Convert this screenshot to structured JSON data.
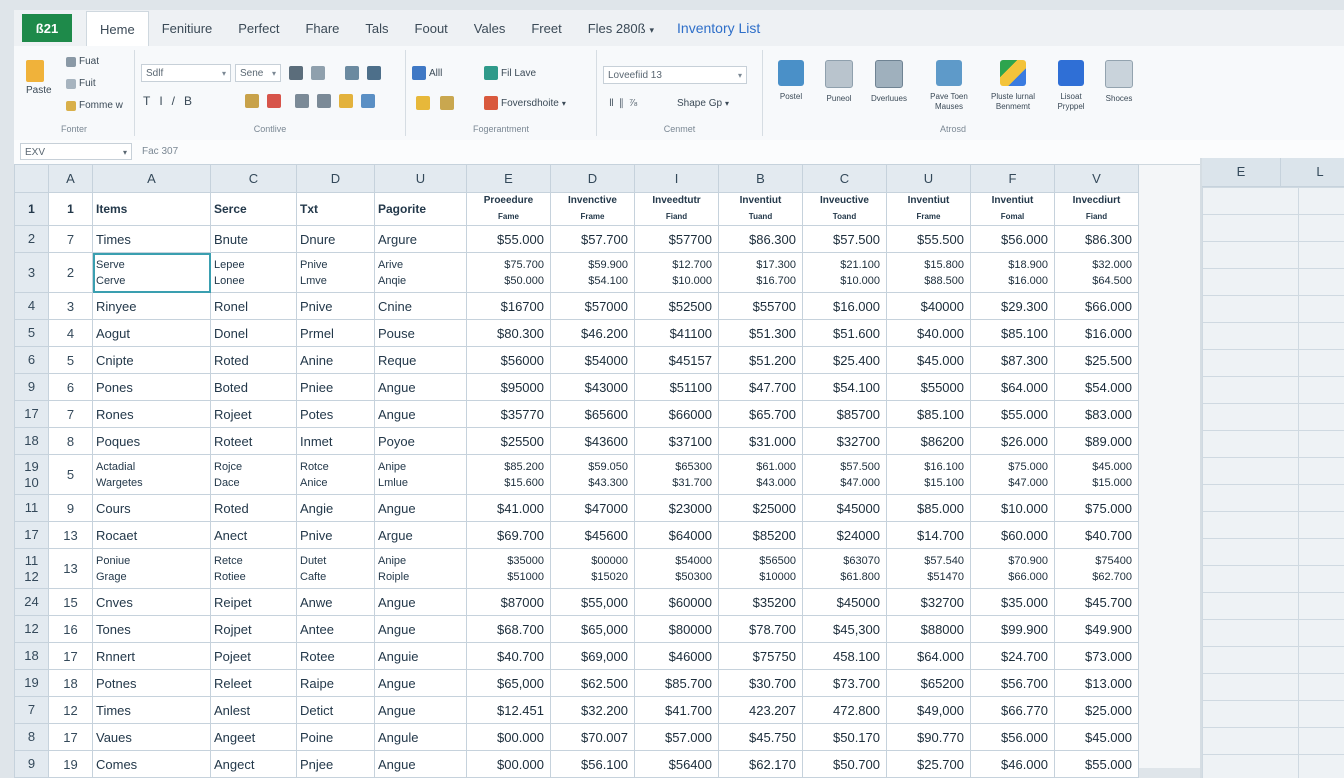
{
  "menubar": {
    "logo": "ß21",
    "tabs": [
      "Heme",
      "Fenitiure",
      "Perfect",
      "Fhare",
      "Tals",
      "Foout",
      "Vales",
      "Freet"
    ],
    "file_selector": "Fles 280ß",
    "doc_title": "Inventory List"
  },
  "ribbon": {
    "clipboard": {
      "paste": "Paste",
      "cut": "Fuat",
      "copy": "Fuit",
      "format": "Fomme w",
      "label": "Fonter"
    },
    "font": {
      "font_name": "Sdlf",
      "size": "Sene",
      "label": "Contlive"
    },
    "alignment": {
      "wrap": "Alll",
      "merge": "Fil Lave",
      "number_format": "Foversdhoite",
      "label": "Fogerantment"
    },
    "number": {
      "format_box": "Loveefiid 13",
      "style_box": "Shape Gp",
      "label": "Cenmet"
    },
    "insert": {
      "buttons": [
        {
          "label": "Postel",
          "icon": "chart-icon"
        },
        {
          "label": "Puneol",
          "icon": "table-icon"
        },
        {
          "label": "Dverluues",
          "icon": "pivot-icon"
        },
        {
          "label": "Pave Toen\nMauses",
          "icon": "picture-icon"
        },
        {
          "label": "Pluste lurnal\nBenmemt",
          "icon": "drive-icon"
        },
        {
          "label": "Lisoat\nPryppel",
          "icon": "form-icon"
        },
        {
          "label": "Shoces",
          "icon": "settings-icon"
        }
      ],
      "label": "Atrosd"
    }
  },
  "formula_bar": {
    "name_box": "EXV",
    "fx": "Fac 307"
  },
  "grid": {
    "col_letters": [
      "A",
      "A",
      "C",
      "D",
      "U",
      "E",
      "D",
      "I",
      "B",
      "C",
      "U",
      "F",
      "V"
    ],
    "header_row": {
      "row_label": "1",
      "idx": "1",
      "cols": [
        "Items",
        "Serce",
        "Txt",
        "Pagorite"
      ],
      "inv_cols": [
        [
          "Proeedure",
          "Fame"
        ],
        [
          "Invenctive",
          "Frame"
        ],
        [
          "Inveedtutr",
          "Fiand"
        ],
        [
          "Inventiut",
          "Tuand"
        ],
        [
          "Inveuctive",
          "Toand"
        ],
        [
          "Inventiut",
          "Frame"
        ],
        [
          "Inventiut",
          "Fomal"
        ],
        [
          "Invecdiurt",
          "Fiand"
        ]
      ]
    },
    "rows": [
      {
        "row": "2",
        "idx": "7",
        "c": [
          "Times",
          "Bnute",
          "Dnure",
          "Argure"
        ],
        "v": [
          "$55.000",
          "$57.700",
          "$57700",
          "$86.300",
          "$57.500",
          "$55.500",
          "$56.000",
          "$86.300"
        ]
      },
      {
        "row": "3",
        "idx": "2",
        "dual": true,
        "c2": [
          [
            "Serve",
            "Cerve"
          ],
          [
            "Lepee",
            "Lonee"
          ],
          [
            "Pnive",
            "Lmve"
          ],
          [
            "Arive",
            "Anqie"
          ]
        ],
        "v2": [
          [
            "$75.700",
            "$50.000"
          ],
          [
            "$59.900",
            "$54.100"
          ],
          [
            "$12.700",
            "$10.000"
          ],
          [
            "$17.300",
            "$16.700"
          ],
          [
            "$21.100",
            "$10.000"
          ],
          [
            "$15.800",
            "$88.500"
          ],
          [
            "$18.900",
            "$16.000"
          ],
          [
            "$32.000",
            "$64.500"
          ]
        ]
      },
      {
        "row": "4",
        "idx": "3",
        "c": [
          "Rinyee",
          "Ronel",
          "Pnive",
          "Cnine"
        ],
        "v": [
          "$16700",
          "$57000",
          "$52500",
          "$55700",
          "$16.000",
          "$40000",
          "$29.300",
          "$66.000"
        ]
      },
      {
        "row": "5",
        "idx": "4",
        "c": [
          "Aogut",
          "Donel",
          "Prmel",
          "Pouse"
        ],
        "v": [
          "$80.300",
          "$46.200",
          "$41100",
          "$51.300",
          "$51.600",
          "$40.000",
          "$85.100",
          "$16.000"
        ]
      },
      {
        "row": "6",
        "idx": "5",
        "c": [
          "Cnipte",
          "Roted",
          "Anine",
          "Reque"
        ],
        "v": [
          "$56000",
          "$54000",
          "$45157",
          "$51.200",
          "$25.400",
          "$45.000",
          "$87.300",
          "$25.500"
        ]
      },
      {
        "row": "9",
        "idx": "6",
        "c": [
          "Pones",
          "Boted",
          "Pniee",
          "Angue"
        ],
        "v": [
          "$95000",
          "$43000",
          "$51100",
          "$47.700",
          "$54.100",
          "$55000",
          "$64.000",
          "$54.000"
        ]
      },
      {
        "row": "17",
        "idx": "7",
        "c": [
          "Rones",
          "Rojeet",
          "Potes",
          "Angue"
        ],
        "v": [
          "$35770",
          "$65600",
          "$66000",
          "$65.700",
          "$85700",
          "$85.100",
          "$55.000",
          "$83.000"
        ]
      },
      {
        "row": "18",
        "idx": "8",
        "c": [
          "Poques",
          "Roteet",
          "Inmet",
          "Poyoe"
        ],
        "v": [
          "$25500",
          "$43600",
          "$37100",
          "$31.000",
          "$32700",
          "$86200",
          "$26.000",
          "$89.000"
        ]
      },
      {
        "row": "19\n10",
        "idx": "5",
        "dual": true,
        "c2": [
          [
            "Actadial",
            "Wargetes"
          ],
          [
            "Rojce",
            "Dace"
          ],
          [
            "Rotce",
            "Anice"
          ],
          [
            "Anipe",
            "Lmlue"
          ]
        ],
        "v2": [
          [
            "$85.200",
            "$15.600"
          ],
          [
            "$59.050",
            "$43.300"
          ],
          [
            "$65300",
            "$31.700"
          ],
          [
            "$61.000",
            "$43.000"
          ],
          [
            "$57.500",
            "$47.000"
          ],
          [
            "$16.100",
            "$15.100"
          ],
          [
            "$75.000",
            "$47.000"
          ],
          [
            "$45.000",
            "$15.000"
          ]
        ]
      },
      {
        "row": "11",
        "idx": "9",
        "c": [
          "Cours",
          "Roted",
          "Angie",
          "Angue"
        ],
        "v": [
          "$41.000",
          "$47000",
          "$23000",
          "$25000",
          "$45000",
          "$85.000",
          "$10.000",
          "$75.000"
        ]
      },
      {
        "row": "17",
        "idx": "13",
        "c": [
          "Rocaet",
          "Anect",
          "Pnive",
          "Argue"
        ],
        "v": [
          "$69.700",
          "$45600",
          "$64000",
          "$85200",
          "$24000",
          "$14.700",
          "$60.000",
          "$40.700"
        ]
      },
      {
        "row": "11\n12",
        "idx": "13",
        "dual": true,
        "c2": [
          [
            "Poniue",
            "Grage"
          ],
          [
            "Retce",
            "Rotiee"
          ],
          [
            "Dutet",
            "Cafte"
          ],
          [
            "Anipe",
            "Roiple"
          ]
        ],
        "v2": [
          [
            "$35000",
            "$51000"
          ],
          [
            "$00000",
            "$15020"
          ],
          [
            "$54000",
            "$50300"
          ],
          [
            "$56500",
            "$10000"
          ],
          [
            "$63070",
            "$61.800"
          ],
          [
            "$57.540",
            "$51470"
          ],
          [
            "$70.900",
            "$66.000"
          ],
          [
            "$75400",
            "$62.700"
          ]
        ]
      },
      {
        "row": "24",
        "idx": "15",
        "c": [
          "Cnves",
          "Reipet",
          "Anwe",
          "Angue"
        ],
        "v": [
          "$87000",
          "$55,000",
          "$60000",
          "$35200",
          "$45000",
          "$32700",
          "$35.000",
          "$45.700"
        ]
      },
      {
        "row": "12",
        "idx": "16",
        "c": [
          "Tones",
          "Rojpet",
          "Antee",
          "Angue"
        ],
        "v": [
          "$68.700",
          "$65,000",
          "$80000",
          "$78.700",
          "$45,300",
          "$88000",
          "$99.900",
          "$49.900"
        ]
      },
      {
        "row": "18",
        "idx": "17",
        "c": [
          "Rnnert",
          "Pojeet",
          "Rotee",
          "Anguie"
        ],
        "v": [
          "$40.700",
          "$69,000",
          "$46000",
          "$75750",
          "458.100",
          "$64.000",
          "$24.700",
          "$73.000"
        ]
      },
      {
        "row": "19",
        "idx": "18",
        "c": [
          "Potnes",
          "Releet",
          "Raipe",
          "Angue"
        ],
        "v": [
          "$65,000",
          "$62.500",
          "$85.700",
          "$30.700",
          "$73.700",
          "$65200",
          "$56.700",
          "$13.000"
        ]
      },
      {
        "row": "7",
        "idx": "12",
        "c": [
          "Times",
          "Anlest",
          "Detict",
          "Angue"
        ],
        "v": [
          "$12.451",
          "$32.200",
          "$41.700",
          "423.207",
          "472.800",
          "$49,000",
          "$66.770",
          "$25.000"
        ]
      },
      {
        "row": "8",
        "idx": "17",
        "c": [
          "Vaues",
          "Angeet",
          "Poine",
          "Angule"
        ],
        "v": [
          "$00.000",
          "$70.007",
          "$57.000",
          "$45.750",
          "$50.170",
          "$90.770",
          "$56.000",
          "$45.000"
        ]
      },
      {
        "row": "9",
        "idx": "19",
        "c": [
          "Comes",
          "Angect",
          "Pnjee",
          "Angue"
        ],
        "v": [
          "$00.000",
          "$56.100",
          "$56400",
          "$62.170",
          "$50.700",
          "$25.700",
          "$46.000",
          "$55.000"
        ]
      }
    ]
  },
  "right_pane": {
    "cols": [
      "E",
      "L"
    ]
  }
}
